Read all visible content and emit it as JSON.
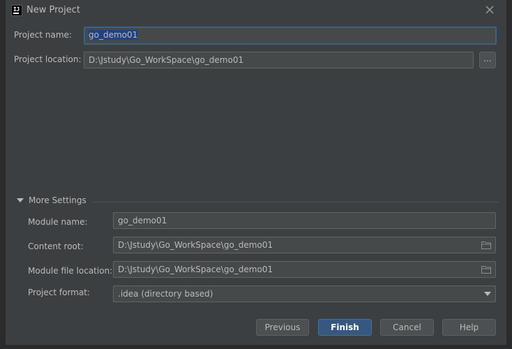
{
  "window": {
    "title": "New Project",
    "close_icon": "close-icon"
  },
  "project": {
    "name_label": "Project name:",
    "name_value": "go_demo01",
    "location_label": "Project location:",
    "location_value": "D:\\Jstudy\\Go_WorkSpace\\go_demo01",
    "browse_label": "..."
  },
  "more_settings": {
    "label": "More Settings",
    "module_name_label": "Module name:",
    "module_name_value": "go_demo01",
    "content_root_label": "Content root:",
    "content_root_value": "D:\\Jstudy\\Go_WorkSpace\\go_demo01",
    "module_file_label": "Module file location:",
    "module_file_value": "D:\\Jstudy\\Go_WorkSpace\\go_demo01",
    "project_format_label": "Project format:",
    "project_format_value": ".idea (directory based)"
  },
  "buttons": {
    "previous": "Previous",
    "finish": "Finish",
    "cancel": "Cancel",
    "help": "Help"
  },
  "colors": {
    "background": "#3c3f41",
    "accent": "#365880",
    "selection": "#214283"
  }
}
